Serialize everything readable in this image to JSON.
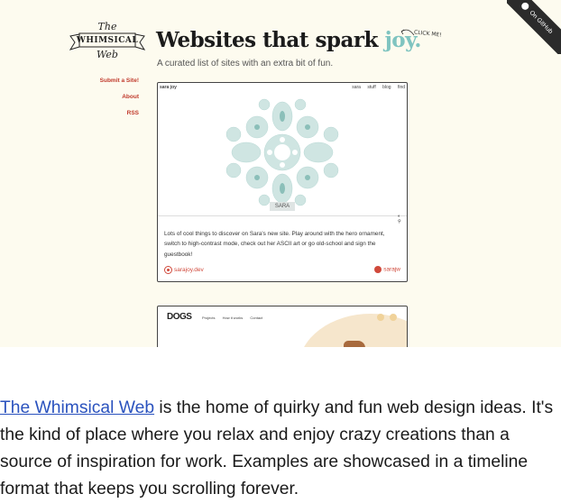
{
  "ribbon": {
    "label": "On GitHub",
    "icon": "github-icon"
  },
  "logo": {
    "line1": "The",
    "line2": "WHIMSICAL",
    "line3": "Web"
  },
  "header": {
    "title_main": "Websites that spark",
    "title_accent": "joy.",
    "click_me": "CLICK ME!",
    "subtitle": "A curated list of sites with an extra bit of fun."
  },
  "nav": {
    "submit": "Submit a Site!",
    "about": "About",
    "rss": "RSS"
  },
  "card": {
    "brand": "sara joy",
    "links": [
      "sara",
      "stuff",
      "blog",
      "find"
    ],
    "tag": "SARA",
    "description": "Lots of cool things to discover on Sara's new site. Play around with the hero ornament, switch to high-contrast mode, check out her ASCII art or go old-school and sign the guestbook!",
    "site_link": "sarajoy.dev",
    "social_link": "sarajw"
  },
  "card2": {
    "brand": "DOGS",
    "nav": [
      "Projects",
      "How it works",
      "Contact"
    ]
  },
  "blurb": {
    "link_text": "The Whimsical Web",
    "text": " is the home of quirky and fun web design ideas. It's the kind of place where you relax and enjoy crazy creations than a source of inspiration for work. Examples are showcased in a timeline format that keeps you scrolling forever."
  },
  "colors": {
    "accent": "#7fc4c0",
    "link": "#c0392b",
    "background": "#fdfbef"
  }
}
